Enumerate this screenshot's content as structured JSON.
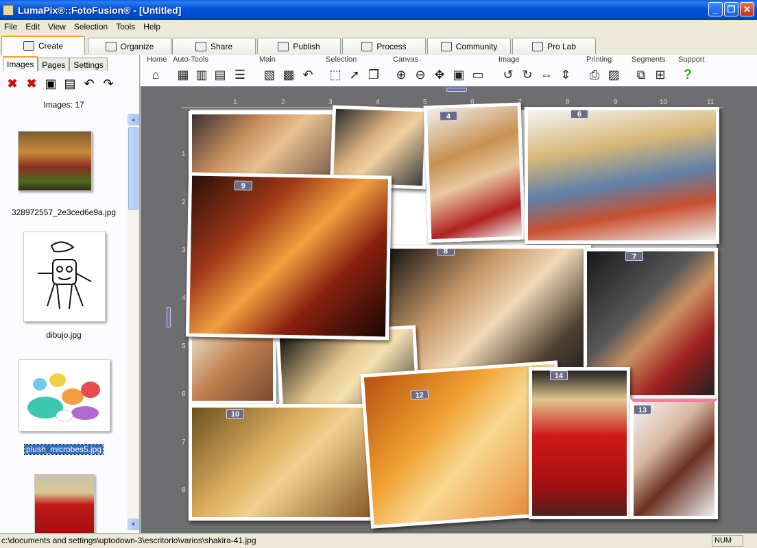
{
  "window": {
    "title": "LumaPix®::FotoFusion® - [Untitled]",
    "minimize": "_",
    "maximize": "❐",
    "close": "✕"
  },
  "menu": [
    "File",
    "Edit",
    "View",
    "Selection",
    "Tools",
    "Help"
  ],
  "main_tabs": [
    {
      "label": "Create",
      "active": true
    },
    {
      "label": "Organize",
      "active": false
    },
    {
      "label": "Share",
      "active": false
    },
    {
      "label": "Publish",
      "active": false
    },
    {
      "label": "Process",
      "active": false
    },
    {
      "label": "Community",
      "active": false
    },
    {
      "label": "Pro Lab",
      "active": false
    }
  ],
  "left_panel": {
    "tabs": [
      {
        "label": "Images",
        "active": true
      },
      {
        "label": "Pages",
        "active": false
      },
      {
        "label": "Settings",
        "active": false
      }
    ],
    "image_count": "Images: 17",
    "thumbnails": [
      {
        "name": "328972557_2e3ced6e9a.jpg",
        "selected": false
      },
      {
        "name": "dibujo.jpg",
        "selected": false
      },
      {
        "name": "plush_microbes5.jpg",
        "selected": true
      },
      {
        "name": "",
        "selected": false
      }
    ]
  },
  "toolbar": {
    "groups": [
      {
        "label": "Home"
      },
      {
        "label": "Auto-Tools"
      },
      {
        "label": "Main"
      },
      {
        "label": "Selection"
      },
      {
        "label": "Canvas"
      },
      {
        "label": "Image"
      },
      {
        "label": "Printing"
      },
      {
        "label": "Segments"
      },
      {
        "label": "Support"
      }
    ],
    "support_icon": "?"
  },
  "canvas": {
    "ruler_top": [
      "1",
      "2",
      "3",
      "4",
      "5",
      "6",
      "7",
      "8",
      "9",
      "10",
      "11"
    ],
    "ruler_left": [
      "1",
      "2",
      "3",
      "4",
      "5",
      "6",
      "7",
      "8"
    ],
    "badges": [
      "4",
      "6",
      "9",
      "8",
      "7",
      "14",
      "12",
      "10",
      "13"
    ]
  },
  "status": {
    "path": "c:\\documents and settings\\uptodown-3\\escritorio\\varios\\shakira-41.jpg",
    "num": "NUM"
  }
}
